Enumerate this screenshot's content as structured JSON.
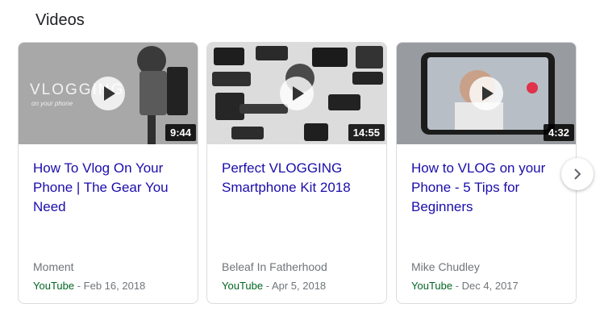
{
  "section": {
    "title": "Videos"
  },
  "videos": [
    {
      "title": "How To Vlog On Your Phone | The Gear You Need",
      "duration": "9:44",
      "channel": "Moment",
      "source": "YouTube",
      "date": "Feb 16, 2018",
      "thumb_text": "VLOGGING",
      "thumb_subtext": "on your phone"
    },
    {
      "title": "Perfect VLOGGING Smartphone Kit 2018",
      "duration": "14:55",
      "channel": "Beleaf In Fatherhood",
      "source": "YouTube",
      "date": "Apr 5, 2018"
    },
    {
      "title": "How to VLOG on your Phone - 5 Tips for Beginners",
      "duration": "4:32",
      "channel": "Mike Chudley",
      "source": "YouTube",
      "date": "Dec 4, 2017"
    }
  ],
  "separator": " - ",
  "icons": {
    "play": "play-icon",
    "next": "chevron-right-icon"
  },
  "colors": {
    "title_link": "#1a0dab",
    "source": "#006621",
    "meta": "#70757a"
  }
}
